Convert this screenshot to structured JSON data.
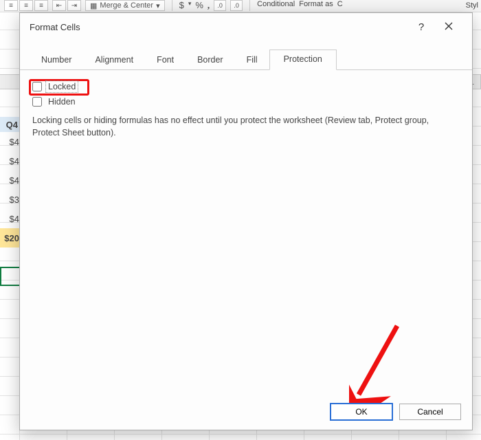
{
  "ribbon": {
    "merge_label": "Merge & Center",
    "currency": "$",
    "percent": "%",
    "comma": ",",
    "dec_inc": ".00→",
    "dec_dec": "→.00",
    "cond_format": "Conditional",
    "format_as": "Format as",
    "cell_styles_c": "C",
    "cell_styles_cut": "Styl"
  },
  "sheet": {
    "col_header_11": "L",
    "q4_label": "Q4",
    "vals": [
      "$4",
      "$4",
      "$4",
      "$3",
      "$4",
      "$20"
    ]
  },
  "dialog": {
    "title": "Format Cells",
    "help": "?",
    "tabs": {
      "number": "Number",
      "alignment": "Alignment",
      "font": "Font",
      "border": "Border",
      "fill": "Fill",
      "protection": "Protection"
    },
    "protection": {
      "locked_label": "Locked",
      "hidden_label": "Hidden",
      "description": "Locking cells or hiding formulas has no effect until you protect the worksheet (Review tab, Protect group, Protect Sheet button)."
    },
    "buttons": {
      "ok": "OK",
      "cancel": "Cancel"
    }
  }
}
